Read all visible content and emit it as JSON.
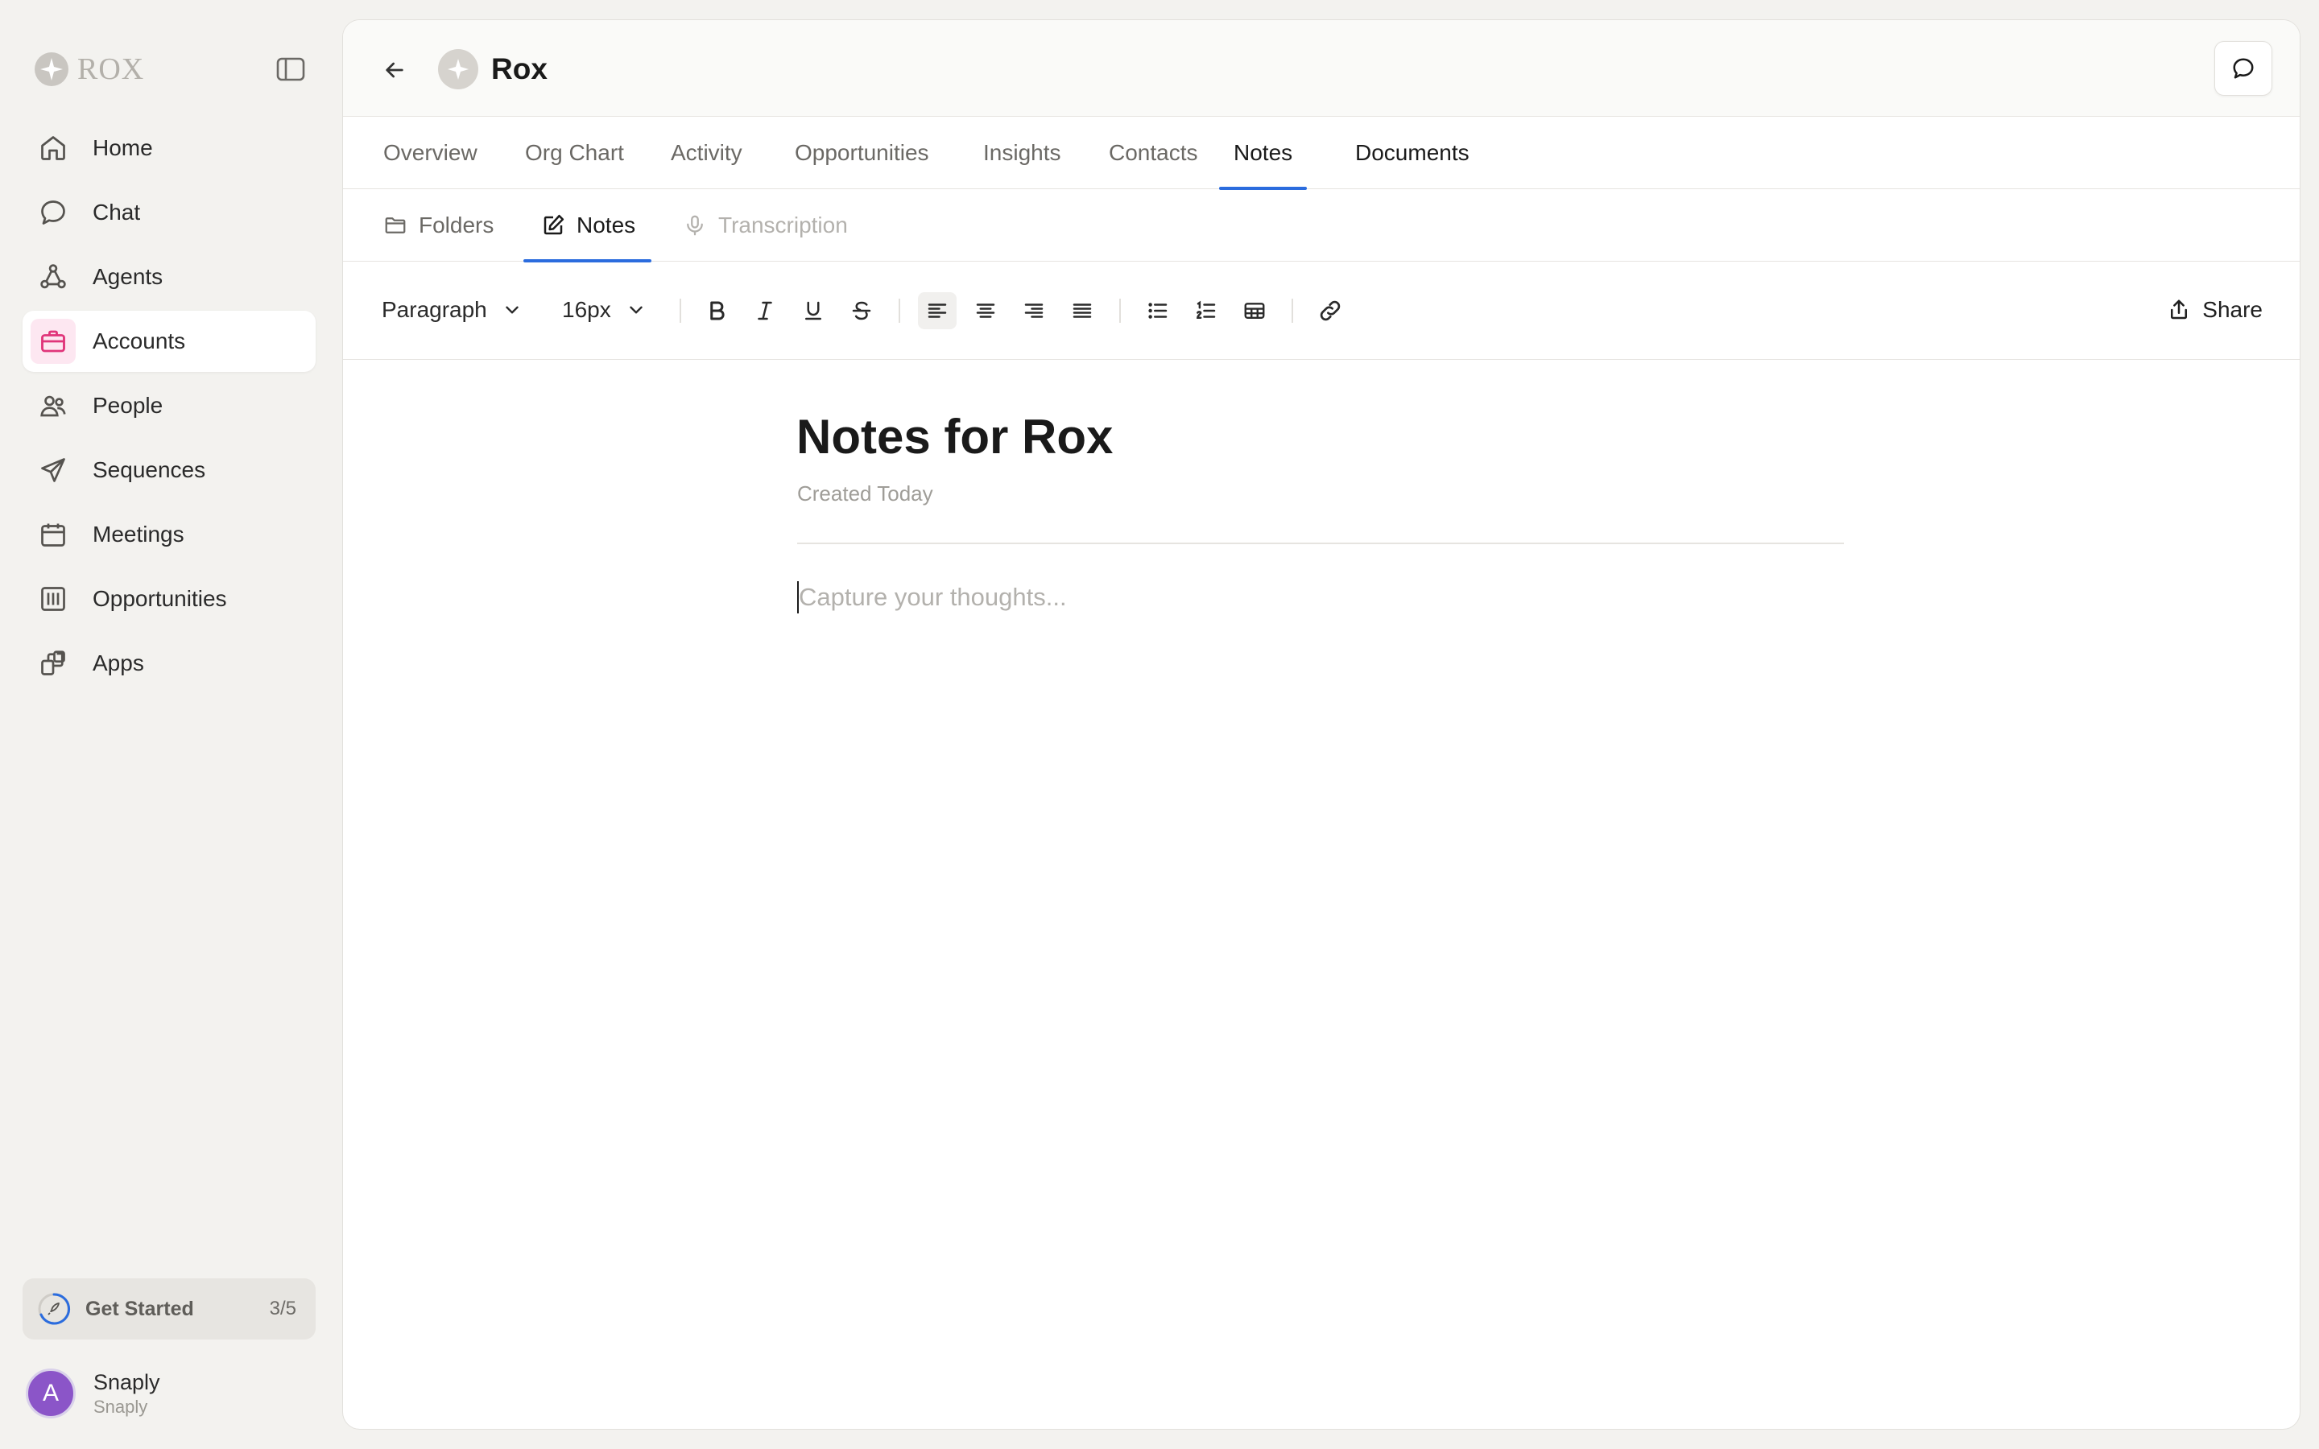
{
  "app": {
    "logo_text": "ROX"
  },
  "sidebar": {
    "items": [
      {
        "label": "Home",
        "icon": "home-icon"
      },
      {
        "label": "Chat",
        "icon": "chat-bubble-icon"
      },
      {
        "label": "Agents",
        "icon": "agents-icon"
      },
      {
        "label": "Accounts",
        "icon": "briefcase-icon",
        "active": true
      },
      {
        "label": "People",
        "icon": "people-icon"
      },
      {
        "label": "Sequences",
        "icon": "send-icon"
      },
      {
        "label": "Meetings",
        "icon": "calendar-icon"
      },
      {
        "label": "Opportunities",
        "icon": "columns-icon"
      },
      {
        "label": "Apps",
        "icon": "apps-icon"
      }
    ],
    "get_started": {
      "label": "Get Started",
      "count": "3/5"
    },
    "user": {
      "initial": "A",
      "name": "Snaply",
      "org": "Snaply"
    }
  },
  "header": {
    "title": "Rox"
  },
  "tabs": [
    {
      "label": "Overview"
    },
    {
      "label": "Org Chart"
    },
    {
      "label": "Activity"
    },
    {
      "label": "Opportunities"
    },
    {
      "label": "Insights"
    },
    {
      "label": "Contacts"
    },
    {
      "label": "Notes",
      "active": true
    },
    {
      "label": "Documents"
    }
  ],
  "subtabs": [
    {
      "label": "Folders"
    },
    {
      "label": "Notes",
      "active": true
    },
    {
      "label": "Transcription",
      "disabled": true
    }
  ],
  "toolbar": {
    "block_type": "Paragraph",
    "font_size": "16px",
    "share_label": "Share",
    "active_alignment": "left"
  },
  "document": {
    "title": "Notes for Rox",
    "meta": "Created Today",
    "placeholder": "Capture your thoughts..."
  },
  "colors": {
    "accent": "#2b6cde",
    "accounts_icon": "#e0357a",
    "avatar": "#8b55c8"
  }
}
